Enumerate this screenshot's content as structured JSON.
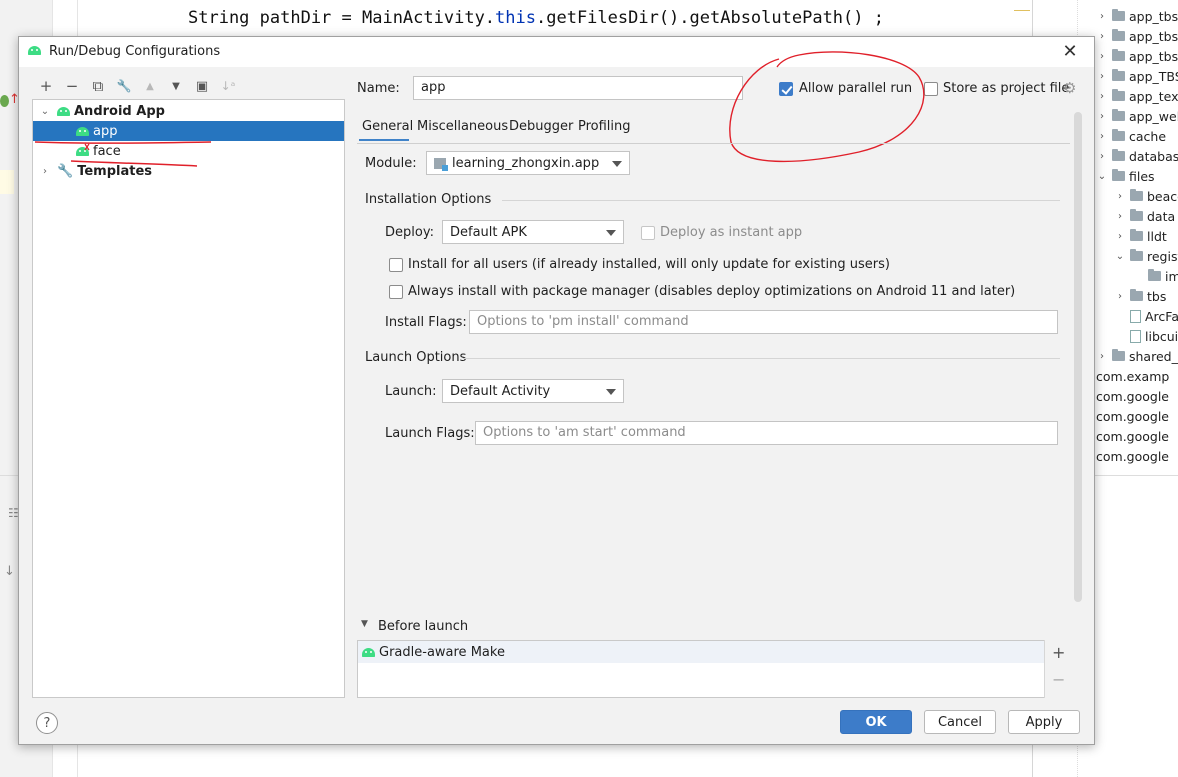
{
  "editor": {
    "code_prefix": "String pathDir = MainActivity.",
    "code_this": "this",
    "code_suffix": ".getFilesDir().getAbsolutePath() ;"
  },
  "project_tree": {
    "items": [
      {
        "label": "app_tbs",
        "kind": "folder",
        "chevron": "›"
      },
      {
        "label": "app_tbs_",
        "kind": "folder",
        "chevron": "›"
      },
      {
        "label": "app_tbs_",
        "kind": "folder",
        "chevron": "›"
      },
      {
        "label": "app_TBS",
        "kind": "folder",
        "chevron": "›"
      },
      {
        "label": "app_text",
        "kind": "folder",
        "chevron": "›"
      },
      {
        "label": "app_web",
        "kind": "folder",
        "chevron": "›"
      },
      {
        "label": "cache",
        "kind": "folder",
        "chevron": "›"
      },
      {
        "label": "database",
        "kind": "folder",
        "chevron": "›"
      },
      {
        "label": "files",
        "kind": "folder",
        "chevron": "⌄"
      },
      {
        "label": "beaco",
        "kind": "folder",
        "chevron": "›"
      },
      {
        "label": "data",
        "kind": "folder",
        "chevron": "›"
      },
      {
        "label": "lldt",
        "kind": "folder",
        "chevron": "›"
      },
      {
        "label": "regist",
        "kind": "folder",
        "chevron": "⌄"
      },
      {
        "label": "im",
        "kind": "folder",
        "chevron": ""
      },
      {
        "label": "tbs",
        "kind": "folder",
        "chevron": "›"
      },
      {
        "label": "ArcFa",
        "kind": "file",
        "chevron": ""
      },
      {
        "label": "libcui",
        "kind": "file",
        "chevron": ""
      },
      {
        "label": "shared_p",
        "kind": "folder",
        "chevron": "›"
      },
      {
        "label": "com.examp",
        "kind": "folder",
        "chevron": "›"
      },
      {
        "label": "com.google",
        "kind": "folder",
        "chevron": "›"
      },
      {
        "label": "com.google",
        "kind": "folder",
        "chevron": "›"
      },
      {
        "label": "com.google",
        "kind": "folder",
        "chevron": "›"
      },
      {
        "label": "com.google",
        "kind": "folder",
        "chevron": "›"
      }
    ]
  },
  "dialog": {
    "title": "Run/Debug Configurations",
    "close_glyph": "✕",
    "toolbar": {
      "add": "+",
      "remove": "−",
      "copy": "⧉",
      "edit": "🔧",
      "up": "▲",
      "down": "▼",
      "folder": "▣",
      "sort": "↓ᵃ"
    },
    "tree": {
      "android_app": "Android App",
      "app": "app",
      "face": "face",
      "templates": "Templates"
    },
    "name_label": "Name:",
    "name_value": "app",
    "allow_parallel_label": "Allow parallel run",
    "allow_parallel_checked": true,
    "store_project_label": "Store as project file",
    "store_project_checked": false,
    "tabs": [
      "General",
      "Miscellaneous",
      "Debugger",
      "Profiling"
    ],
    "active_tab": "General",
    "module_label": "Module:",
    "module_value": "learning_zhongxin.app",
    "installation_options": "Installation Options",
    "deploy_label": "Deploy:",
    "deploy_value": "Default APK",
    "instant_app_label": "Deploy as instant app",
    "install_all_users_label": "Install for all users (if already installed, will only update for existing users)",
    "always_install_label": "Always install with package manager (disables deploy optimizations on Android 11 and later)",
    "install_flags_label": "Install Flags:",
    "install_flags_placeholder": "Options to 'pm install' command",
    "launch_options": "Launch Options",
    "launch_label": "Launch:",
    "launch_value": "Default Activity",
    "launch_flags_label": "Launch Flags:",
    "launch_flags_placeholder": "Options to 'am start' command",
    "before_launch": "Before launch",
    "before_launch_item": "Gradle-aware Make",
    "bl_add": "+",
    "bl_remove": "−",
    "help": "?",
    "ok": "OK",
    "cancel": "Cancel",
    "apply": "Apply",
    "colors": {
      "selection": "#2675bf",
      "primary_button": "#3d7cc9",
      "annotation": "#e0202a",
      "android_green": "#3ddc84"
    }
  }
}
